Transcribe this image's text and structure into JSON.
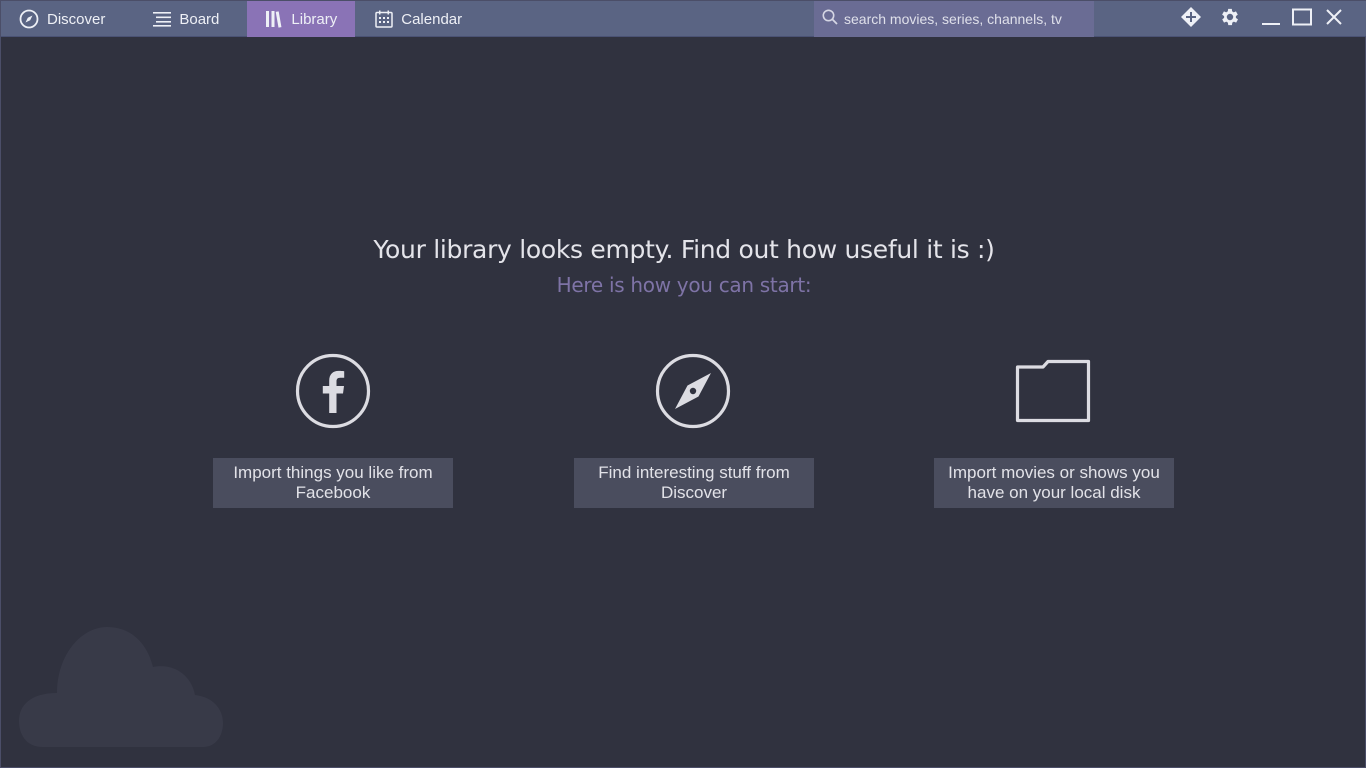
{
  "nav": {
    "tabs": [
      {
        "label": "Discover",
        "icon": "compass-icon"
      },
      {
        "label": "Board",
        "icon": "list-icon"
      },
      {
        "label": "Library",
        "icon": "library-icon",
        "active": true
      },
      {
        "label": "Calendar",
        "icon": "calendar-icon"
      }
    ]
  },
  "search": {
    "placeholder": "search movies, series, channels, tv"
  },
  "toolbar_icons": [
    "addons-icon",
    "gear-icon",
    "minimize-icon",
    "maximize-icon",
    "close-icon"
  ],
  "empty_state": {
    "headline": "Your library looks empty. Find out how useful it is :)",
    "subline": "Here is how you can start:",
    "options": [
      {
        "icon": "facebook-icon",
        "label": "Import things you like from Facebook"
      },
      {
        "icon": "compass-icon",
        "label": "Find interesting stuff from Discover"
      },
      {
        "icon": "folder-icon",
        "label": "Import movies or shows you have on your local disk"
      }
    ]
  },
  "colors": {
    "background": "#30323f",
    "topbar": "#5a6483",
    "active_tab": "#8a73b6",
    "search_bg": "#6a6c94",
    "button_bg": "#4a4d5e",
    "subline": "#7e73a6"
  }
}
